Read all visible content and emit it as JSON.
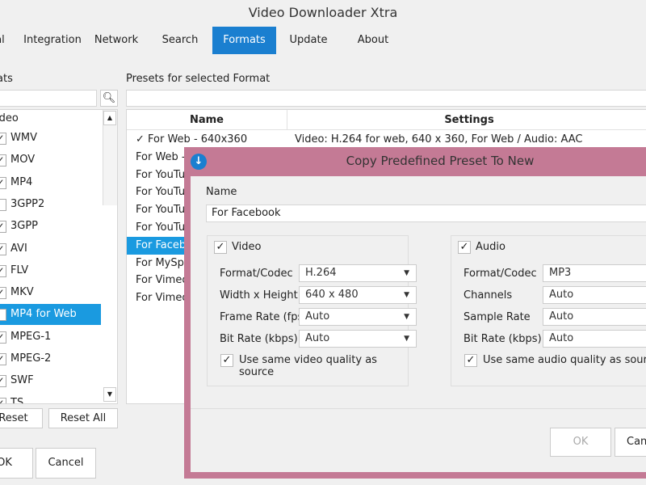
{
  "window": {
    "title": "Video Downloader Xtra"
  },
  "tabs": [
    {
      "label": "al"
    },
    {
      "label": "Integration"
    },
    {
      "label": "Network"
    },
    {
      "label": "Search"
    },
    {
      "label": "Formats"
    },
    {
      "label": "Update"
    },
    {
      "label": "About"
    }
  ],
  "formats": {
    "label": "ats",
    "search_value": "",
    "group": "ideo",
    "items": [
      {
        "label": "WMV",
        "checked": true
      },
      {
        "label": "MOV",
        "checked": true
      },
      {
        "label": "MP4",
        "checked": true
      },
      {
        "label": "3GPP2",
        "checked": false
      },
      {
        "label": "3GPP",
        "checked": true
      },
      {
        "label": "AVI",
        "checked": true
      },
      {
        "label": "FLV",
        "checked": true
      },
      {
        "label": "MKV",
        "checked": true
      },
      {
        "label": "MP4 for Web",
        "checked": true
      },
      {
        "label": "MPEG-1",
        "checked": true
      },
      {
        "label": "MPEG-2",
        "checked": true
      },
      {
        "label": "SWF",
        "checked": true
      },
      {
        "label": "TS",
        "checked": true
      }
    ],
    "selected": "MP4 for Web",
    "reset": "Reset",
    "reset_all": "Reset All"
  },
  "presets": {
    "label": "Presets for selected Format",
    "search_value": "",
    "col_name": "Name",
    "col_settings": "Settings",
    "rows": [
      {
        "name": "✓ For Web - 640x360",
        "settings": "Video: H.264 for web, 640 x 360, For Web / Audio: AAC"
      },
      {
        "name": "For Web -",
        "settings": ""
      },
      {
        "name": "For YouTu",
        "settings": ""
      },
      {
        "name": "For YouTu",
        "settings": ""
      },
      {
        "name": "For YouTu",
        "settings": ""
      },
      {
        "name": "For YouTu",
        "settings": ""
      },
      {
        "name": "For Facebo",
        "settings": ""
      },
      {
        "name": "For MySpa",
        "settings": ""
      },
      {
        "name": "For Vimeo",
        "settings": ""
      },
      {
        "name": "For Vimeo",
        "settings": ""
      }
    ],
    "selected_index": 6
  },
  "footer": {
    "ok": "OK",
    "cancel": "Cancel"
  },
  "dialog": {
    "title": "Copy Predefined Preset To New",
    "name_label": "Name",
    "name_value": "For Facebook",
    "video": {
      "label": "Video",
      "checked": true,
      "fields": [
        {
          "label": "Format/Codec",
          "value": "H.264"
        },
        {
          "label": "Width x Height",
          "value": "640 x 480"
        },
        {
          "label": "Frame Rate (fps)",
          "value": "Auto"
        },
        {
          "label": "Bit Rate (kbps)",
          "value": "Auto"
        }
      ],
      "same_quality": "Use same video quality as source"
    },
    "audio": {
      "label": "Audio",
      "checked": true,
      "fields": [
        {
          "label": "Format/Codec",
          "value": "MP3"
        },
        {
          "label": "Channels",
          "value": "Auto"
        },
        {
          "label": "Sample Rate",
          "value": "Auto"
        },
        {
          "label": "Bit Rate (kbps)",
          "value": "Auto"
        }
      ],
      "same_quality": "Use same audio quality as source"
    },
    "ok": "OK",
    "cancel": "Can",
    "colors": {
      "border": "#c47a95",
      "accent": "#1a7fd0",
      "selection": "#1a9ae0"
    }
  }
}
